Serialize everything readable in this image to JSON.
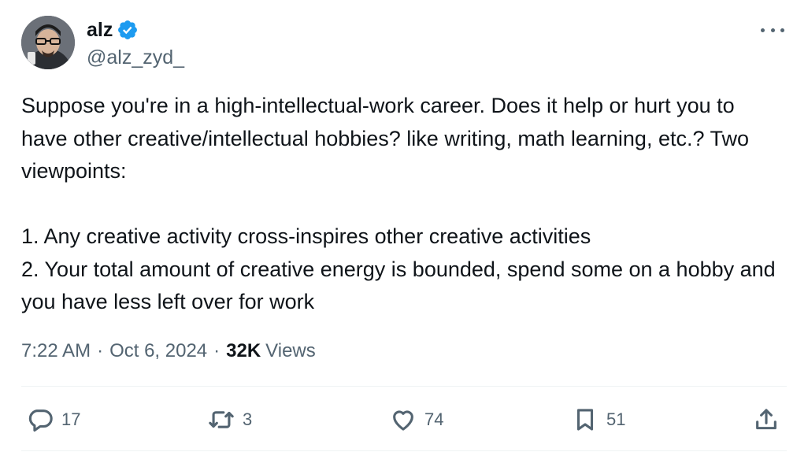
{
  "author": {
    "display_name": "alz",
    "handle": "@alz_zyd_",
    "verified": true,
    "verified_color": "#1d9bf0"
  },
  "tweet": {
    "paragraphs": [
      "Suppose you're in a high-intellectual-work career. Does it help or hurt you to have other creative/intellectual hobbies? like writing, math learning, etc.? Two viewpoints:",
      "1. Any creative activity cross-inspires other creative activities\n2. Your total amount of creative energy is bounded, spend some on a hobby and you have less left over for work"
    ],
    "time": "7:22 AM",
    "date": "Oct 6, 2024",
    "dot": "·",
    "views_count": "32K",
    "views_label": "Views"
  },
  "actions": {
    "reply": {
      "icon": "reply-icon",
      "count": "17"
    },
    "retweet": {
      "icon": "retweet-icon",
      "count": "3"
    },
    "like": {
      "icon": "heart-icon",
      "count": "74"
    },
    "bookmark": {
      "icon": "bookmark-icon",
      "count": "51"
    },
    "share": {
      "icon": "share-icon"
    }
  },
  "colors": {
    "text_primary": "#0f1419",
    "text_secondary": "#536471",
    "divider": "#eff3f4"
  }
}
